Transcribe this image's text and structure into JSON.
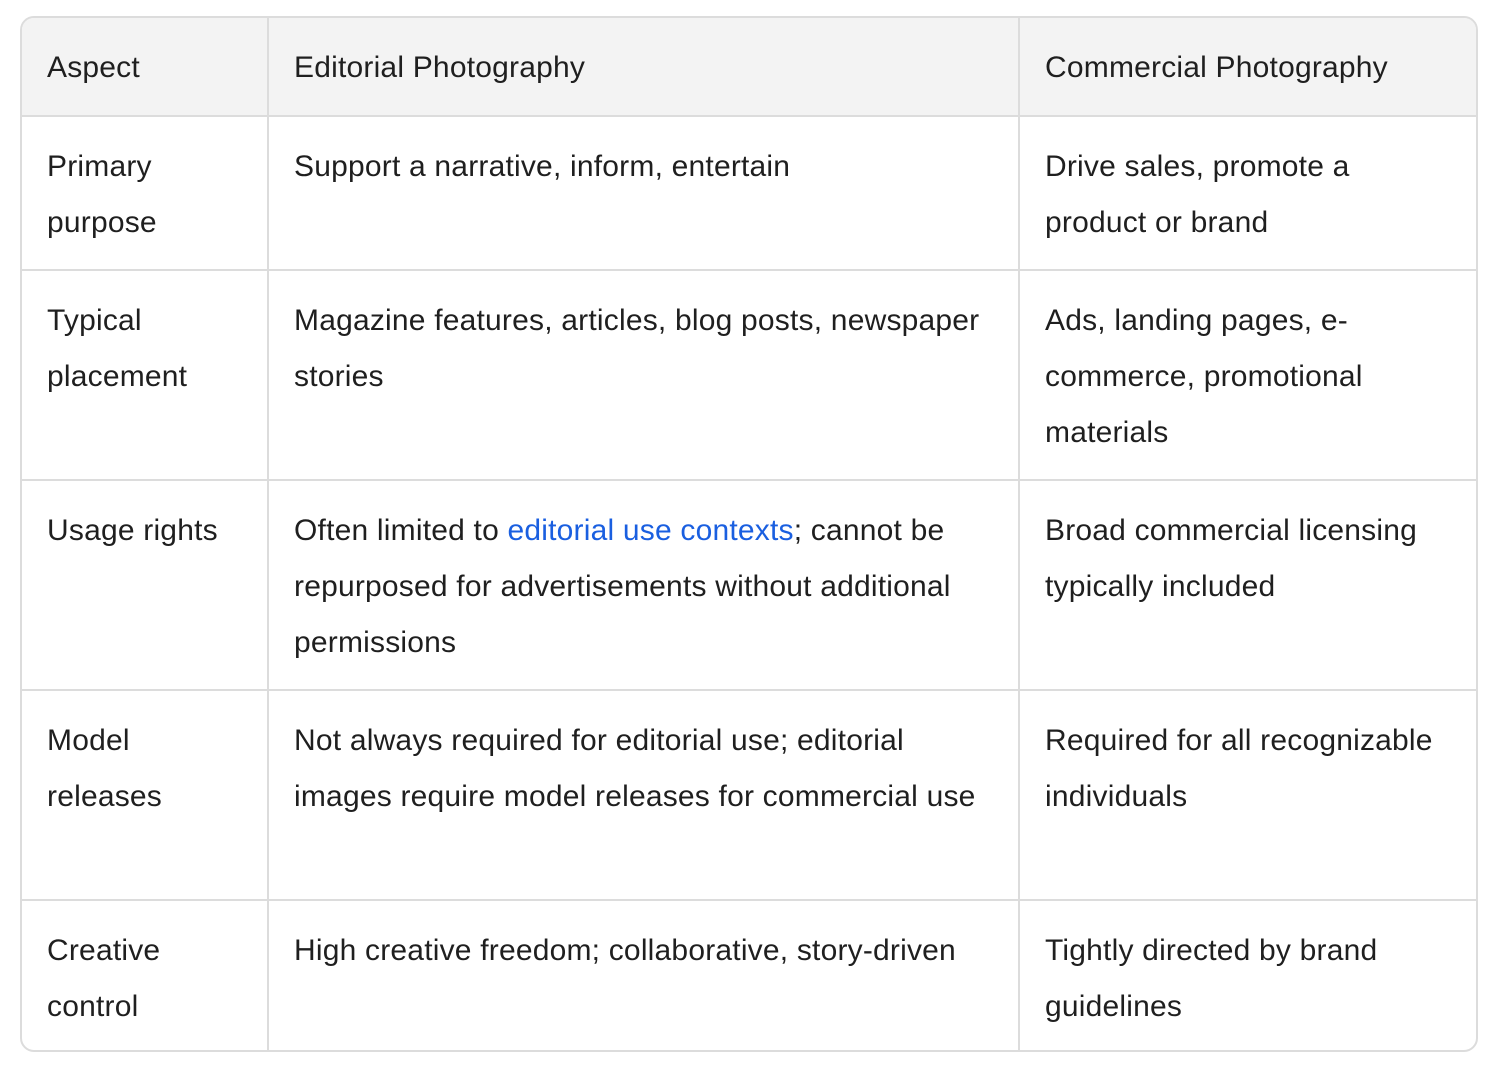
{
  "table": {
    "headers": [
      "Aspect",
      "Editorial Photography",
      "Commercial Photography"
    ],
    "rows": [
      {
        "aspect": "Primary purpose",
        "editorial": "Support a narrative, inform, entertain",
        "commercial": "Drive sales, promote a product or brand"
      },
      {
        "aspect": "Typical placement",
        "editorial": "Magazine features, articles, blog posts, newspaper stories",
        "commercial": "Ads, landing pages, e-commerce, promotional materials"
      },
      {
        "aspect": "Usage rights",
        "editorial_before": "Often limited to ",
        "editorial_link": "editorial use contexts",
        "editorial_after": "; cannot be repurposed for advertisements without additional permissions",
        "commercial": "Broad commercial licensing typically included"
      },
      {
        "aspect": "Model releases",
        "editorial": "Not always required for editorial use; editorial images require model releases for commercial use",
        "commercial": "Required for all recognizable individuals"
      },
      {
        "aspect": "Creative control",
        "editorial": "High creative freedom; collaborative, story-driven",
        "commercial": "Tightly directed by brand guidelines"
      }
    ]
  },
  "colors": {
    "header_bg": "#f3f3f3",
    "border": "#dcdcdc",
    "link": "#1a5fe0",
    "text": "#1f1f1f"
  }
}
